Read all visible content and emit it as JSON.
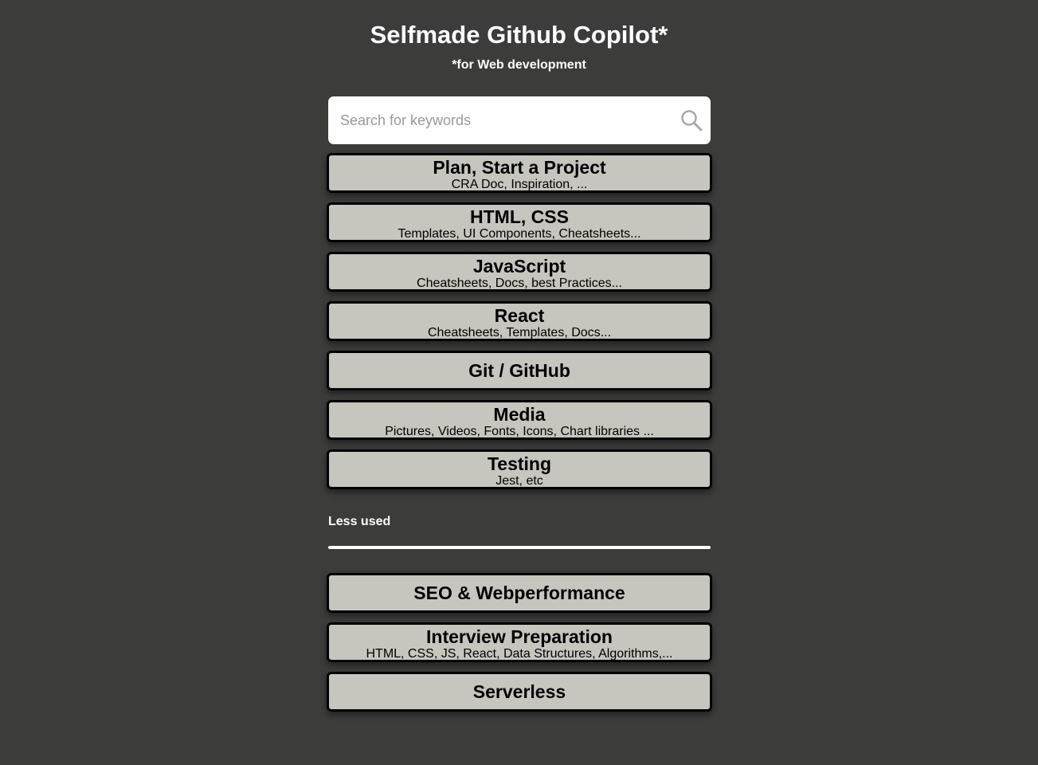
{
  "header": {
    "title": "Selfmade Github Copilot*",
    "subtitle": "*for Web development"
  },
  "search": {
    "placeholder": "Search for keywords",
    "value": "",
    "icon": "search-icon"
  },
  "categories": [
    {
      "title": "Plan, Start a Project",
      "subtitle": "CRA Doc, Inspiration, ..."
    },
    {
      "title": "HTML, CSS",
      "subtitle": "Templates, UI Components, Cheatsheets..."
    },
    {
      "title": "JavaScript",
      "subtitle": "Cheatsheets, Docs, best Practices..."
    },
    {
      "title": "React",
      "subtitle": "Cheatsheets, Templates, Docs..."
    },
    {
      "title": "Git / GitHub"
    },
    {
      "title": "Media",
      "subtitle": "Pictures, Videos, Fonts, Icons, Chart libraries ..."
    },
    {
      "title": "Testing",
      "subtitle": "Jest, etc"
    }
  ],
  "less_used": {
    "label": "Less used",
    "items": [
      {
        "title": "SEO & Webperformance"
      },
      {
        "title": "Interview Preparation",
        "subtitle": "HTML, CSS, JS, React, Data Structures, Algorithms,..."
      },
      {
        "title": "Serverless"
      }
    ]
  },
  "colors": {
    "background": "#3c3c3b",
    "card": "#c6c5be",
    "card_border": "#000000",
    "text_light": "#ffffff"
  }
}
